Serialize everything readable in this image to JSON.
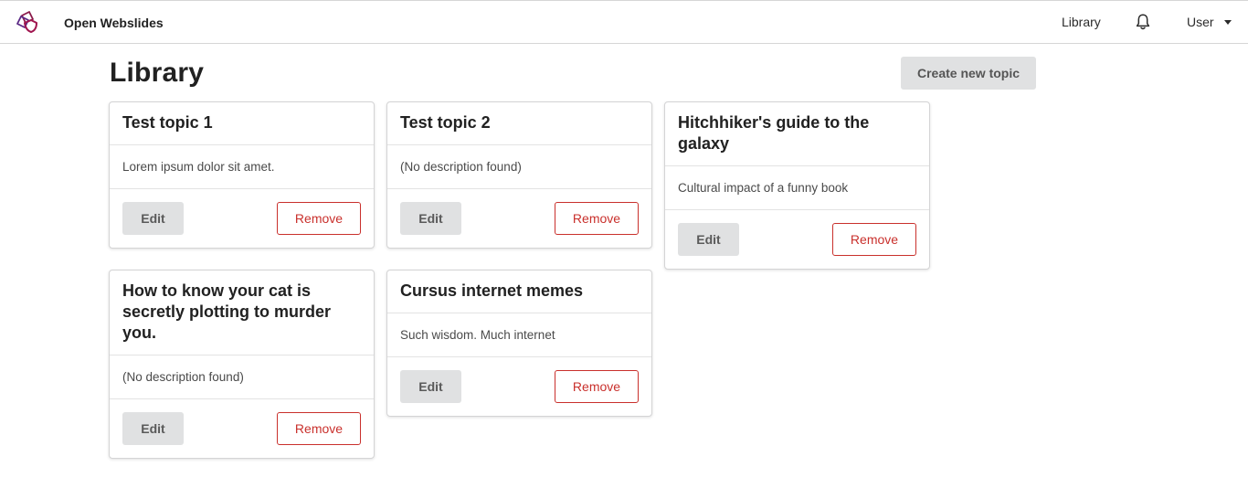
{
  "app": {
    "name": "Open Webslides",
    "brand_color": "#8b1a4a"
  },
  "navbar": {
    "library_label": "Library",
    "bell_icon": "bell-icon",
    "user_label": "User"
  },
  "page": {
    "title": "Library",
    "create_button_label": "Create new topic"
  },
  "topics": [
    {
      "title": "Test topic 1",
      "description": "Lorem ipsum dolor sit amet.",
      "edit_label": "Edit",
      "remove_label": "Remove"
    },
    {
      "title": "Test topic 2",
      "description": "(No description found)",
      "edit_label": "Edit",
      "remove_label": "Remove"
    },
    {
      "title": "Hitchhiker's guide to the galaxy",
      "description": "Cultural impact of a funny book",
      "edit_label": "Edit",
      "remove_label": "Remove"
    },
    {
      "title": "How to know your cat is secretly plotting to murder you.",
      "description": "(No description found)",
      "edit_label": "Edit",
      "remove_label": "Remove"
    },
    {
      "title": "Cursus internet memes",
      "description": "Such wisdom. Much internet",
      "edit_label": "Edit",
      "remove_label": "Remove"
    }
  ],
  "colors": {
    "danger": "#c9302c",
    "button_grey": "#e0e1e2"
  }
}
